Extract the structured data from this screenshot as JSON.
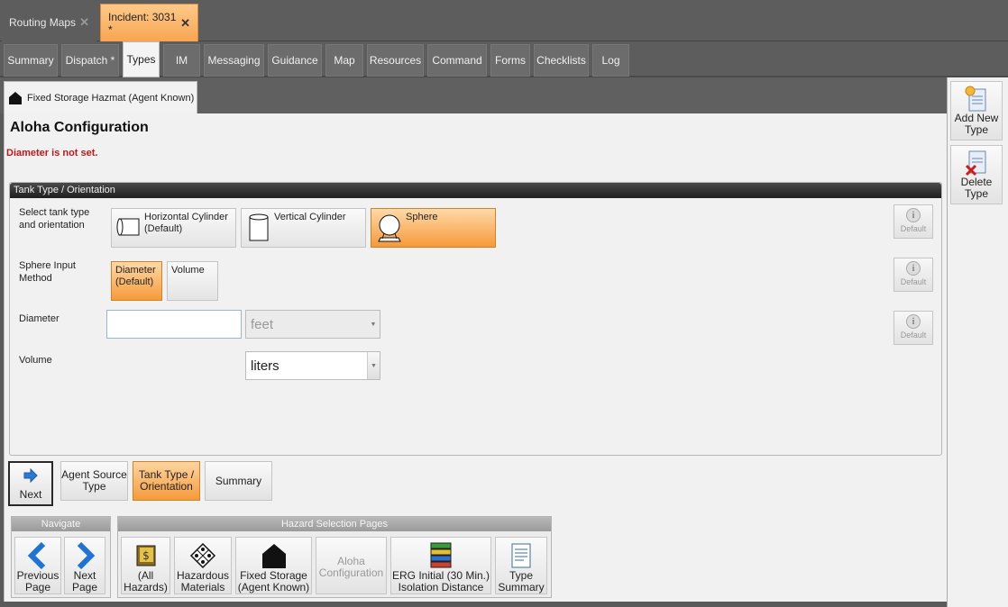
{
  "doc_tabs": {
    "routing": {
      "label": "Routing Maps",
      "close": "✕"
    },
    "incident": {
      "label": "Incident: 3031 *",
      "close": "✕"
    }
  },
  "sub_tabs": [
    "Summary",
    "Dispatch *",
    "Types",
    "IM",
    "Messaging",
    "Guidance",
    "Map",
    "Resources",
    "Command",
    "Forms",
    "Checklists",
    "Log"
  ],
  "type_tab": {
    "label": "Fixed Storage Hazmat (Agent Known)"
  },
  "main": {
    "title": "Aloha Configuration",
    "error": "Diameter is not set."
  },
  "group": {
    "header": "Tank Type / Orientation",
    "tank_label": "Select tank type and orientation",
    "tank_options": {
      "horizontal": "Horizontal Cylinder (Default)",
      "vertical": "Vertical Cylinder",
      "sphere": "Sphere"
    },
    "sphere_label": "Sphere Input Method",
    "sphere_options": {
      "diameter": "Diameter (Default)",
      "volume": "Volume"
    },
    "diameter_label": "Diameter",
    "diameter_value": "",
    "diameter_unit": "feet",
    "volume_label": "Volume",
    "volume_unit": "liters",
    "default_label": "Default",
    "info_glyph": "i"
  },
  "wizard": {
    "next": "Next",
    "agent_source": "Agent Source Type",
    "tank_type": "Tank Type / Orientation",
    "summary": "Summary"
  },
  "navigate": {
    "header": "Navigate",
    "previous": "Previous Page",
    "next": "Next Page"
  },
  "hazard_pages": {
    "header": "Hazard Selection Pages",
    "all": "(All Hazards)",
    "hazardous": "Hazardous Materials",
    "fixed": "Fixed Storage (Agent Known)",
    "aloha": "Aloha Configuration",
    "erg": "ERG Initial (30 Min.) Isolation Distance",
    "type_summary": "Type Summary"
  },
  "side": {
    "add": "Add New Type",
    "delete": "Delete Type"
  },
  "colors": {
    "accent_orange": "#f59a3a",
    "error_red": "#c0171c",
    "nav_blue": "#1f73d6"
  }
}
